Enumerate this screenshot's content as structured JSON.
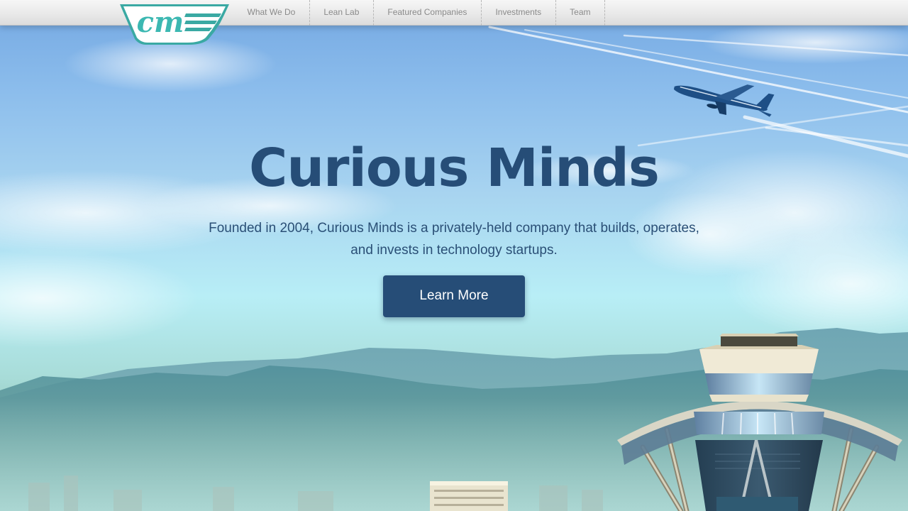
{
  "brand": {
    "logo_text": "cm",
    "colors": {
      "logo_teal": "#3cb8b2",
      "heading_navy": "#264d77",
      "nav_text": "#8a8a8a"
    }
  },
  "nav": {
    "items": [
      {
        "label": "What We Do"
      },
      {
        "label": "Lean Lab"
      },
      {
        "label": "Featured Companies"
      },
      {
        "label": "Investments"
      },
      {
        "label": "Team"
      }
    ]
  },
  "hero": {
    "title": "Curious Minds",
    "subtitle_line1": "Founded in 2004, Curious Minds is a privately-held company that builds, operates,",
    "subtitle_line2": "and invests in technology startups.",
    "cta_label": "Learn More"
  },
  "illustration": {
    "elements": [
      "sky-clouds",
      "contrails",
      "airplane",
      "mountain-range",
      "city-skyline",
      "control-tower"
    ]
  }
}
